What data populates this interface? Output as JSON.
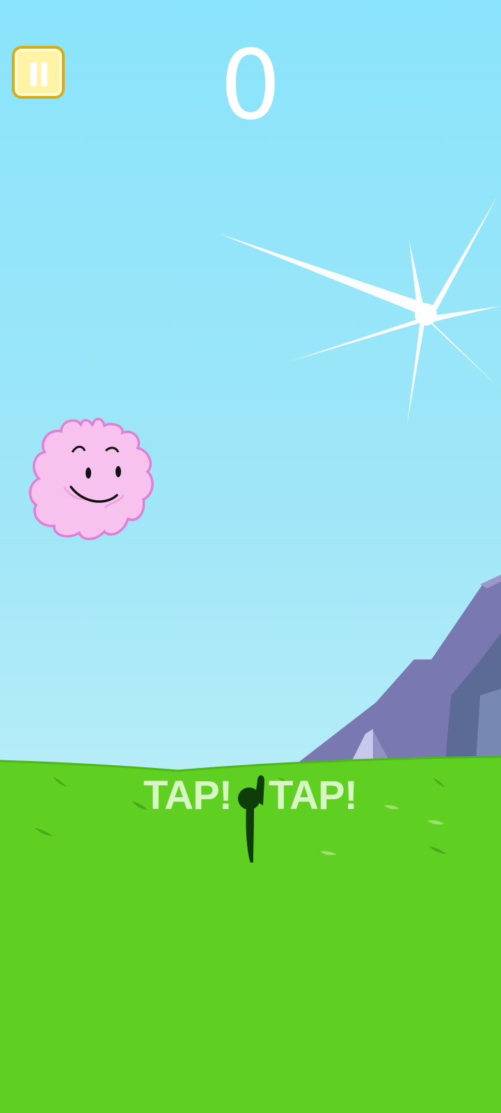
{
  "hud": {
    "score": "0",
    "pause_icon": "pause-icon"
  },
  "tutorial": {
    "tap_left": "TAP!",
    "tap_right": "TAP!",
    "hand_icon": "finger-tap-icon"
  },
  "character": {
    "name_icon": "pink-fluffy-cloud-character"
  },
  "colors": {
    "sky_top": "#8ae4fb",
    "sky_bottom": "#bdeef8",
    "grass": "#5fcf22",
    "mountain": "#7a77b0",
    "pause_fill": "#fff3a6",
    "pause_border": "#d4ad17",
    "character_fill": "#f7c3ee",
    "character_outline": "#e07fd3"
  }
}
